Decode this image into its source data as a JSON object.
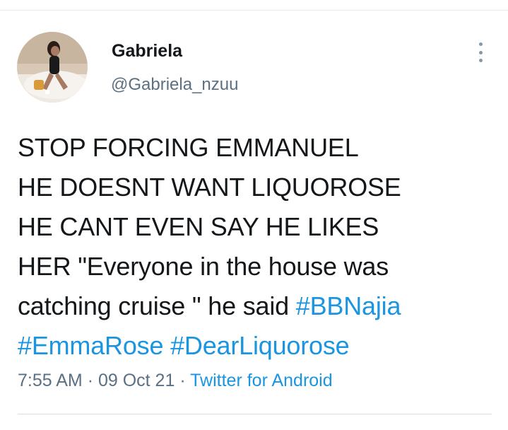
{
  "author": {
    "name": "Gabriela",
    "handle": "@Gabriela_nzuu"
  },
  "tweet": {
    "lines": [
      "STOP FORCING EMMANUEL",
      "HE DOESNT WANT LIQUOROSE",
      "HE CANT EVEN SAY HE LIKES",
      "HER \"Everyone in the house was",
      "catching cruise \" he said "
    ],
    "hashtags": [
      "#BBNajia",
      "#EmmaRose",
      "#DearLiquorose"
    ]
  },
  "meta": {
    "time": "7:55 AM",
    "separator": "·",
    "date": "09 Oct 21",
    "source": "Twitter for Android"
  },
  "icons": {
    "more": "more-vertical-icon"
  },
  "colors": {
    "text": "#14171a",
    "secondary": "#5b7083",
    "link": "#1b95e0",
    "divider": "#e6ecf0"
  }
}
